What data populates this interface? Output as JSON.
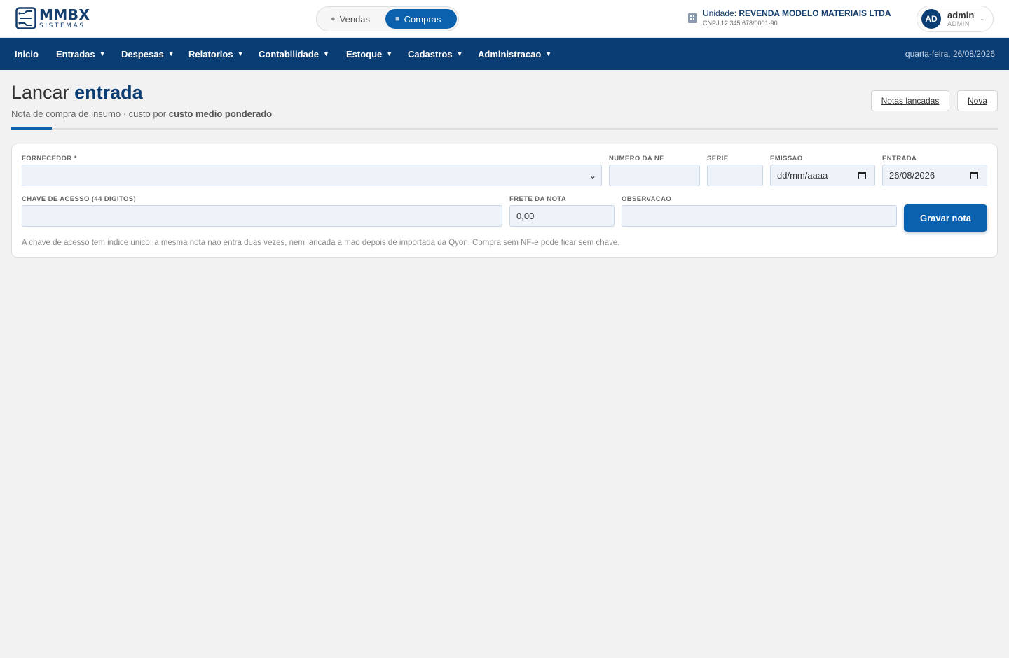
{
  "brand": {
    "name": "MMBX",
    "tagline": "SISTEMAS"
  },
  "mode_toggle": {
    "vendas_label": "Vendas",
    "compras_label": "Compras",
    "active": "Compras"
  },
  "unit": {
    "prefix": "Unidade:",
    "name": "REVENDA MODELO MATERIAIS LTDA",
    "cnpj": "CNPJ 12.345.678/0001-90"
  },
  "user": {
    "initials": "AD",
    "name": "admin",
    "role": "ADMIN"
  },
  "nav": {
    "items": [
      {
        "label": "Inicio",
        "dropdown": false
      },
      {
        "label": "Entradas",
        "dropdown": true
      },
      {
        "label": "Despesas",
        "dropdown": true
      },
      {
        "label": "Relatorios",
        "dropdown": true
      },
      {
        "label": "Contabilidade",
        "dropdown": true
      },
      {
        "label": "Estoque",
        "dropdown": true
      },
      {
        "label": "Cadastros",
        "dropdown": true
      },
      {
        "label": "Administracao",
        "dropdown": true
      }
    ],
    "date": "quarta-feira, 26/08/2026"
  },
  "page": {
    "title_plain": "Lancar",
    "title_accent": "entrada",
    "subtitle_prefix": "Nota de compra de insumo · custo por",
    "subtitle_bold": "custo medio ponderado",
    "btn_notas": "Notas lancadas",
    "btn_nova": "Nova"
  },
  "form": {
    "fornecedor": {
      "label": "FORNECEDOR *",
      "value": ""
    },
    "numero_nf": {
      "label": "NUMERO DA NF",
      "value": ""
    },
    "serie": {
      "label": "SERIE",
      "value": ""
    },
    "emissao": {
      "label": "EMISSAO",
      "value": "dd/mm/aaaa"
    },
    "entrada": {
      "label": "ENTRADA",
      "value": "26/08/2026"
    },
    "chave": {
      "label": "CHAVE DE ACESSO (44 DIGITOS)",
      "value": ""
    },
    "frete": {
      "label": "FRETE DA NOTA",
      "value": "0,00"
    },
    "observacao": {
      "label": "OBSERVACAO",
      "value": ""
    },
    "submit": "Gravar nota",
    "hint": "A chave de acesso tem indice unico: a mesma nota nao entra duas vezes, nem lancada a mao depois de importada da Qyon. Compra sem NF-e pode ficar sem chave."
  },
  "colors": {
    "primary": "#0b61ad",
    "nav_bg": "#0b3d75",
    "field_bg": "#eef3fa"
  }
}
